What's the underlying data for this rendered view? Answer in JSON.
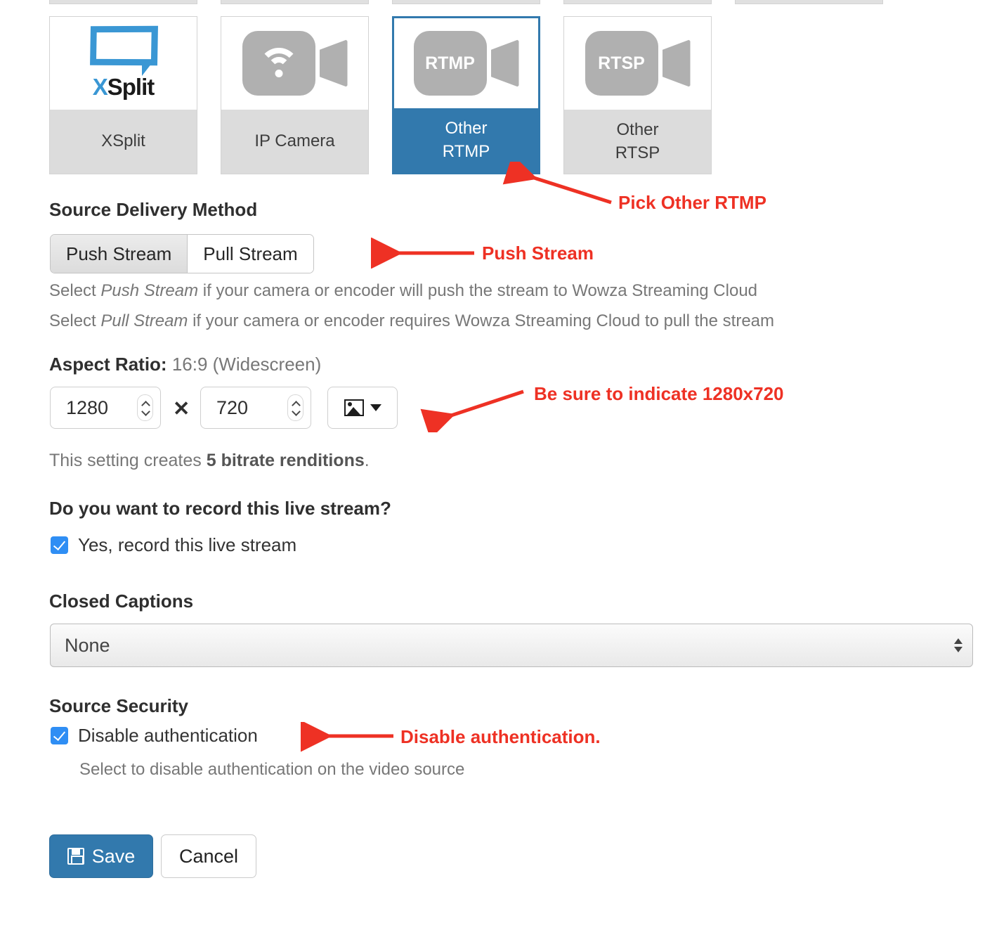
{
  "source_tiles": [
    {
      "label_line1": "XSplit",
      "label_line2": "",
      "icon": "xsplit-logo",
      "selected": false
    },
    {
      "label_line1": "IP Camera",
      "label_line2": "",
      "icon": "wifi-camera-icon",
      "selected": false
    },
    {
      "label_line1": "Other",
      "label_line2": "RTMP",
      "icon": "rtmp-camera-icon",
      "icon_text": "RTMP",
      "selected": true
    },
    {
      "label_line1": "Other",
      "label_line2": "RTSP",
      "icon": "rtsp-camera-icon",
      "icon_text": "RTSP",
      "selected": false
    }
  ],
  "delivery": {
    "title": "Source Delivery Method",
    "options": [
      {
        "label": "Push Stream",
        "selected": true
      },
      {
        "label": "Pull Stream",
        "selected": false
      }
    ],
    "help_line1_a": "Select ",
    "help_line1_em": "Push Stream",
    "help_line1_b": " if your camera or encoder will push the stream to Wowza Streaming Cloud",
    "help_line2_a": "Select ",
    "help_line2_em": "Pull Stream",
    "help_line2_b": " if your camera or encoder requires Wowza Streaming Cloud to pull the stream"
  },
  "aspect": {
    "label": "Aspect Ratio:",
    "value": "16:9 (Widescreen)",
    "width": "1280",
    "height": "720",
    "separator": "✕",
    "preset_icon": "picture-icon",
    "note_a": "This setting creates ",
    "note_b": "5 bitrate renditions",
    "note_c": "."
  },
  "record": {
    "question": "Do you want to record this live stream?",
    "checkbox_label": "Yes, record this live stream",
    "checked": true
  },
  "captions": {
    "title": "Closed Captions",
    "selected": "None"
  },
  "security": {
    "title": "Source Security",
    "checkbox_label": "Disable authentication",
    "checked": true,
    "help": "Select to disable authentication on the video source"
  },
  "actions": {
    "save_label": "Save",
    "save_icon": "floppy-disk-icon",
    "cancel_label": "Cancel"
  },
  "annotations": [
    {
      "text": "Pick Other RTMP"
    },
    {
      "text": "Push Stream"
    },
    {
      "text": "Be sure to indicate 1280x720"
    },
    {
      "text": "Disable authentication."
    }
  ],
  "colors": {
    "accent_blue": "#3279ad",
    "annotation_red": "#ee3124",
    "checkbox_blue": "#2f8ef4",
    "tile_label_gray": "#dcdcdc"
  }
}
